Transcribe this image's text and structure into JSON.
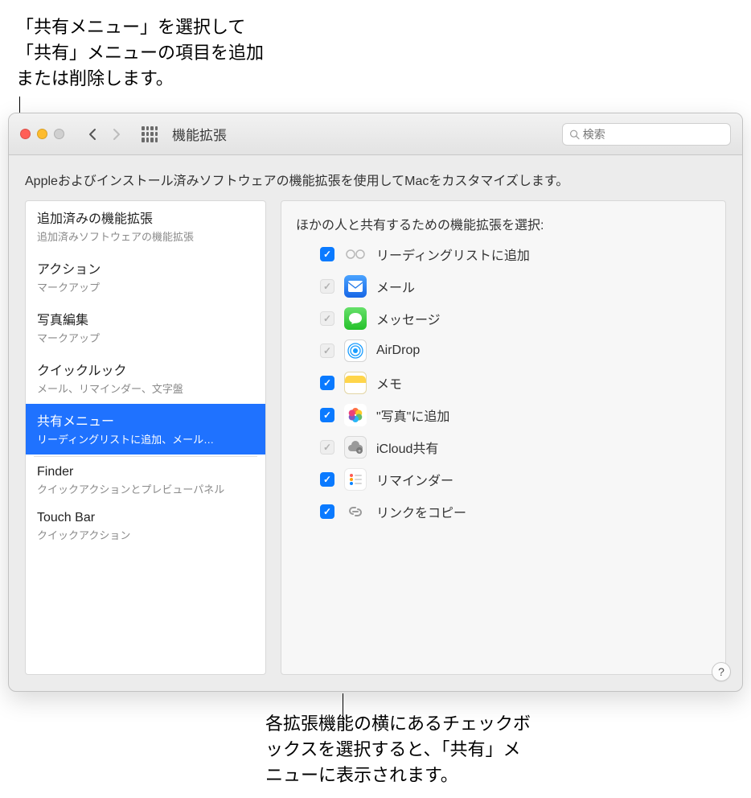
{
  "callouts": {
    "top": "「共有メニュー」を選択して「共有」メニューの項目を追加または削除します。",
    "bottom": "各拡張機能の横にあるチェックボックスを選択すると、「共有」メニューに表示されます。"
  },
  "window": {
    "title": "機能拡張",
    "search_placeholder": "検索",
    "description": "Appleおよびインストール済みソフトウェアの機能拡張を使用してMacをカスタマイズします。"
  },
  "sidebar": [
    {
      "title": "追加済みの機能拡張",
      "sub": "追加済みソフトウェアの機能拡張",
      "selected": false
    },
    {
      "title": "アクション",
      "sub": "マークアップ",
      "selected": false
    },
    {
      "title": "写真編集",
      "sub": "マークアップ",
      "selected": false
    },
    {
      "title": "クイックルック",
      "sub": "メール、リマインダー、文字盤",
      "selected": false
    },
    {
      "title": "共有メニュー",
      "sub": "リーディングリストに追加、メール…",
      "selected": true
    },
    {
      "title": "Finder",
      "sub": "クイックアクションとプレビューパネル",
      "selected": false,
      "dividerBefore": true
    },
    {
      "title": "Touch Bar",
      "sub": "クイックアクション",
      "selected": false
    }
  ],
  "detail": {
    "heading": "ほかの人と共有するための機能拡張を選択:",
    "items": [
      {
        "label": "リーディングリストに追加",
        "state": "checked",
        "icon": "reading"
      },
      {
        "label": "メール",
        "state": "locked",
        "icon": "mail"
      },
      {
        "label": "メッセージ",
        "state": "locked",
        "icon": "msg"
      },
      {
        "label": "AirDrop",
        "state": "locked",
        "icon": "airdrop"
      },
      {
        "label": "メモ",
        "state": "checked",
        "icon": "notes"
      },
      {
        "label": "\"写真\"に追加",
        "state": "checked",
        "icon": "photos"
      },
      {
        "label": "iCloud共有",
        "state": "locked",
        "icon": "icloud"
      },
      {
        "label": "リマインダー",
        "state": "checked",
        "icon": "reminders"
      },
      {
        "label": "リンクをコピー",
        "state": "checked",
        "icon": "link"
      }
    ]
  },
  "help_label": "?"
}
